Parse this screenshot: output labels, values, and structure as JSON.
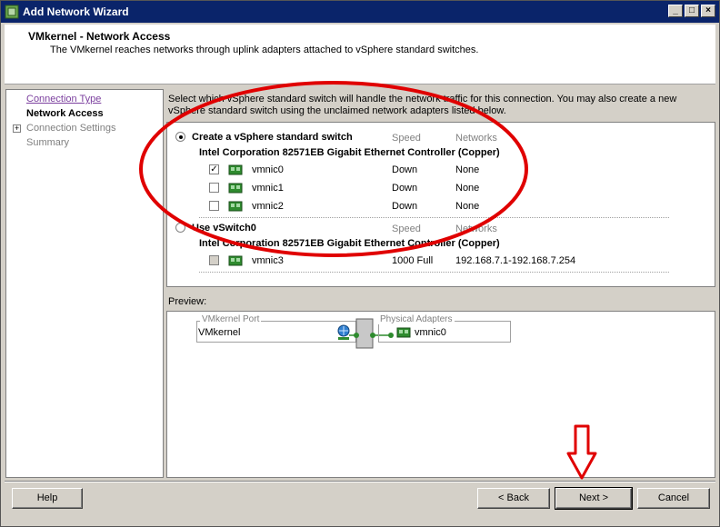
{
  "window": {
    "title": "Add Network Wizard",
    "controls": [
      "_",
      "□",
      "×"
    ]
  },
  "header": {
    "title": "VMkernel - Network Access",
    "description": "The VMkernel reaches networks through uplink adapters attached to vSphere standard switches."
  },
  "nav": {
    "items": [
      {
        "label": "Connection Type",
        "state": "link"
      },
      {
        "label": "Network Access",
        "state": "active"
      },
      {
        "label": "Connection Settings",
        "state": "disabled",
        "expandable": true
      },
      {
        "label": "Summary",
        "state": "disabled"
      }
    ]
  },
  "instruction": "Select which vSphere standard switch will handle the network traffic for this connection. You may also create a new vSphere standard switch using the unclaimed network adapters listed below.",
  "switch_options": [
    {
      "label": "Create a vSphere standard switch",
      "selected": true,
      "speed_header": "Speed",
      "networks_header": "Networks",
      "group": "Intel Corporation 82571EB Gigabit Ethernet Controller (Copper)",
      "nics": [
        {
          "name": "vmnic0",
          "speed": "Down",
          "networks": "None",
          "checked": true,
          "enabled": true
        },
        {
          "name": "vmnic1",
          "speed": "Down",
          "networks": "None",
          "checked": false,
          "enabled": true
        },
        {
          "name": "vmnic2",
          "speed": "Down",
          "networks": "None",
          "checked": false,
          "enabled": true
        }
      ]
    },
    {
      "label": "Use vSwitch0",
      "selected": false,
      "speed_header": "Speed",
      "networks_header": "Networks",
      "group": "Intel Corporation 82571EB Gigabit Ethernet Controller (Copper)",
      "nics": [
        {
          "name": "vmnic3",
          "speed": "1000 Full",
          "networks": "192.168.7.1-192.168.7.254",
          "checked": false,
          "enabled": false
        }
      ]
    }
  ],
  "preview": {
    "label": "Preview:",
    "port_group_legend": "VMkernel Port",
    "port_group_name": "VMkernel",
    "adapters_legend": "Physical Adapters",
    "adapter": "vmnic0"
  },
  "buttons": {
    "help": "Help",
    "back": "< Back",
    "next": "Next >",
    "cancel": "Cancel"
  },
  "colors": {
    "title_bar": "#0a246a",
    "annotation_red": "#e00000",
    "nic_green": "#2e8b2e",
    "link_purple": "#7b3f9e"
  }
}
